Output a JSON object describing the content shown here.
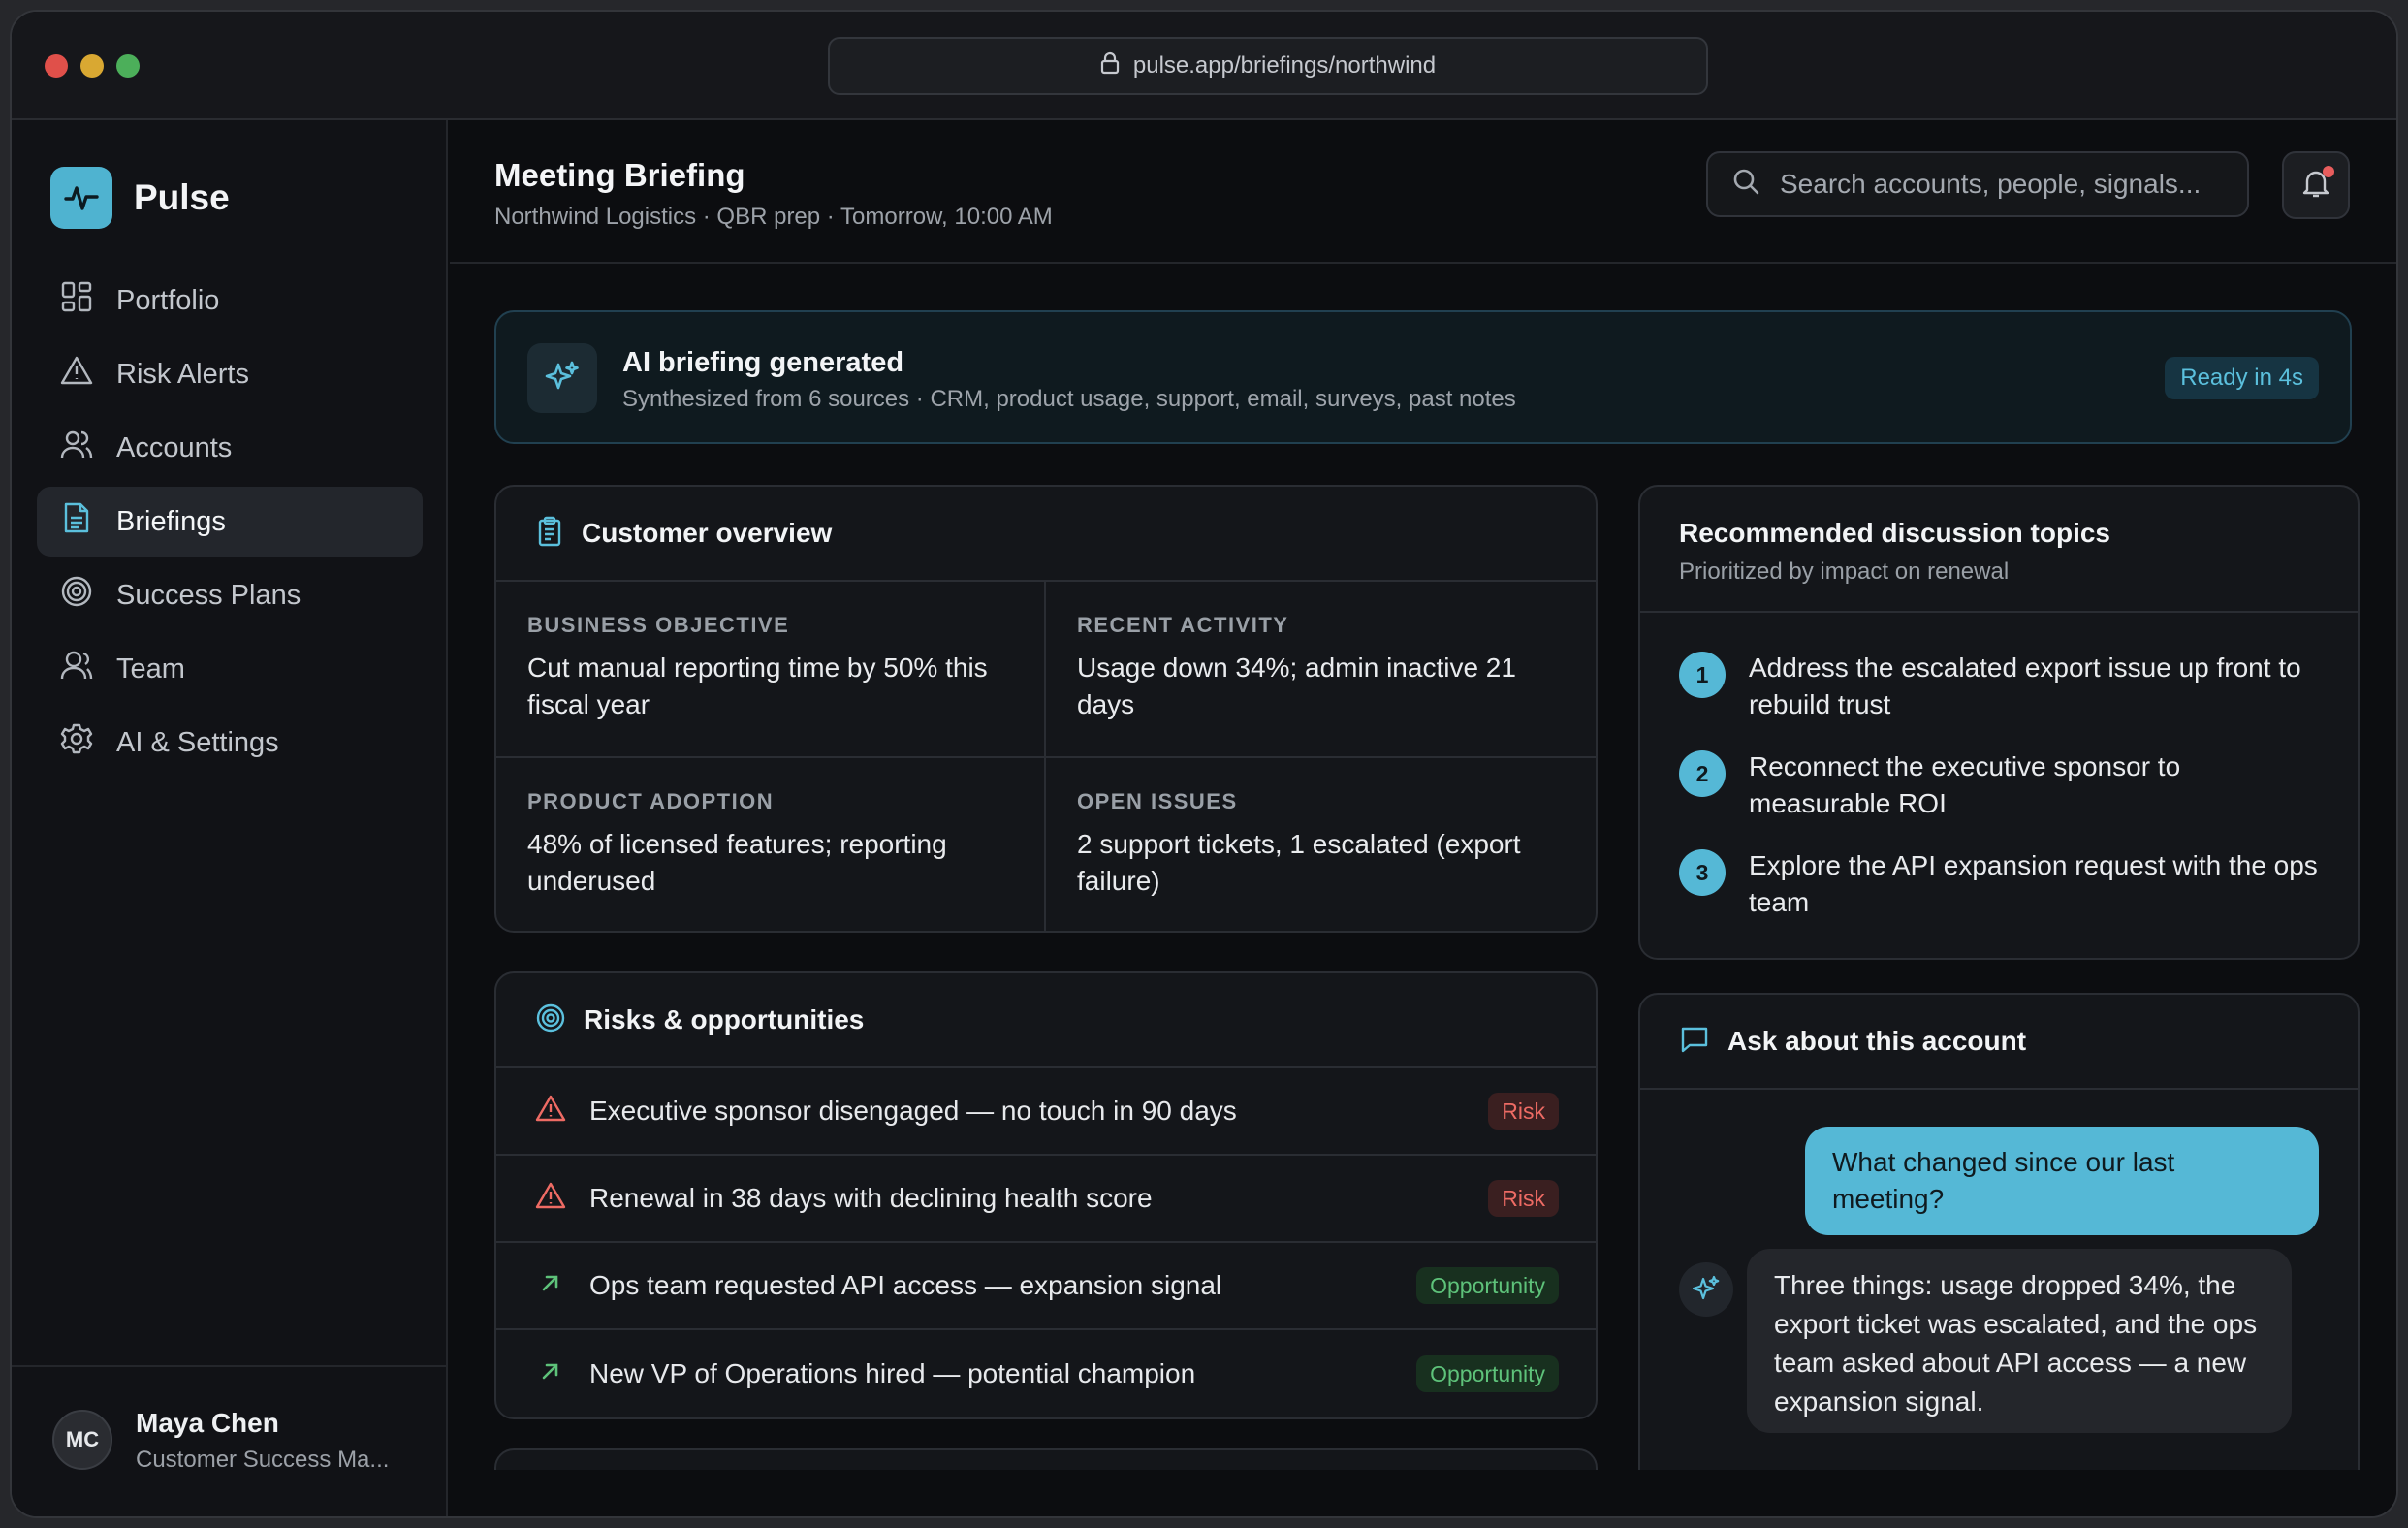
{
  "browser": {
    "url": "pulse.app/briefings/northwind"
  },
  "window_dots": [
    "#e0504a",
    "#d9a832",
    "#4caf5a"
  ],
  "brand": {
    "name": "Pulse",
    "accent": "#4fb3d0"
  },
  "sidebar": {
    "items": [
      {
        "label": "Portfolio",
        "icon": "grid-icon",
        "active": false
      },
      {
        "label": "Risk Alerts",
        "icon": "warning-icon",
        "active": false
      },
      {
        "label": "Accounts",
        "icon": "users-icon",
        "active": false
      },
      {
        "label": "Briefings",
        "icon": "document-icon",
        "active": true
      },
      {
        "label": "Success Plans",
        "icon": "target-icon",
        "active": false
      },
      {
        "label": "Team",
        "icon": "team-icon",
        "active": false
      },
      {
        "label": "AI & Settings",
        "icon": "gear-icon",
        "active": false
      }
    ],
    "user": {
      "initials": "MC",
      "name": "Maya Chen",
      "role": "Customer Success Ma..."
    }
  },
  "header": {
    "title": "Meeting Briefing",
    "subtitle": "Northwind Logistics · QBR prep · Tomorrow, 10:00 AM",
    "search_placeholder": "Search accounts, people, signals..."
  },
  "banner": {
    "title": "AI briefing generated",
    "subtitle": "Synthesized from 6 sources · CRM, product usage, support, email, surveys, past notes",
    "badge": "Ready in 4s"
  },
  "overview": {
    "title": "Customer overview",
    "cells": [
      {
        "label": "BUSINESS OBJECTIVE",
        "value": "Cut manual reporting time by 50% this fiscal year"
      },
      {
        "label": "RECENT ACTIVITY",
        "value": "Usage down 34%; admin inactive 21 days"
      },
      {
        "label": "PRODUCT ADOPTION",
        "value": "48% of licensed features; reporting underused"
      },
      {
        "label": "OPEN ISSUES",
        "value": "2 support tickets, 1 escalated (export failure)"
      }
    ]
  },
  "risks": {
    "title": "Risks & opportunities",
    "items": [
      {
        "text": "Executive sponsor disengaged — no touch in 90 days",
        "tag": "Risk",
        "kind": "risk"
      },
      {
        "text": "Renewal in 38 days with declining health score",
        "tag": "Risk",
        "kind": "risk"
      },
      {
        "text": "Ops team requested API access — expansion signal",
        "tag": "Opportunity",
        "kind": "opportunity"
      },
      {
        "text": "New VP of Operations hired — potential champion",
        "tag": "Opportunity",
        "kind": "opportunity"
      }
    ]
  },
  "topics": {
    "title": "Recommended discussion topics",
    "subtitle": "Prioritized by impact on renewal",
    "items": [
      {
        "num": "1",
        "text": "Address the escalated export issue up front to rebuild trust"
      },
      {
        "num": "2",
        "text": "Reconnect the executive sponsor to measurable ROI"
      },
      {
        "num": "3",
        "text": "Explore the API expansion request with the ops team"
      }
    ]
  },
  "ask": {
    "title": "Ask about this account",
    "user_message": "What changed since our last meeting?",
    "ai_message": "Three things: usage dropped 34%, the export ticket was escalated, and the ops team asked about API access — a new expansion signal."
  }
}
